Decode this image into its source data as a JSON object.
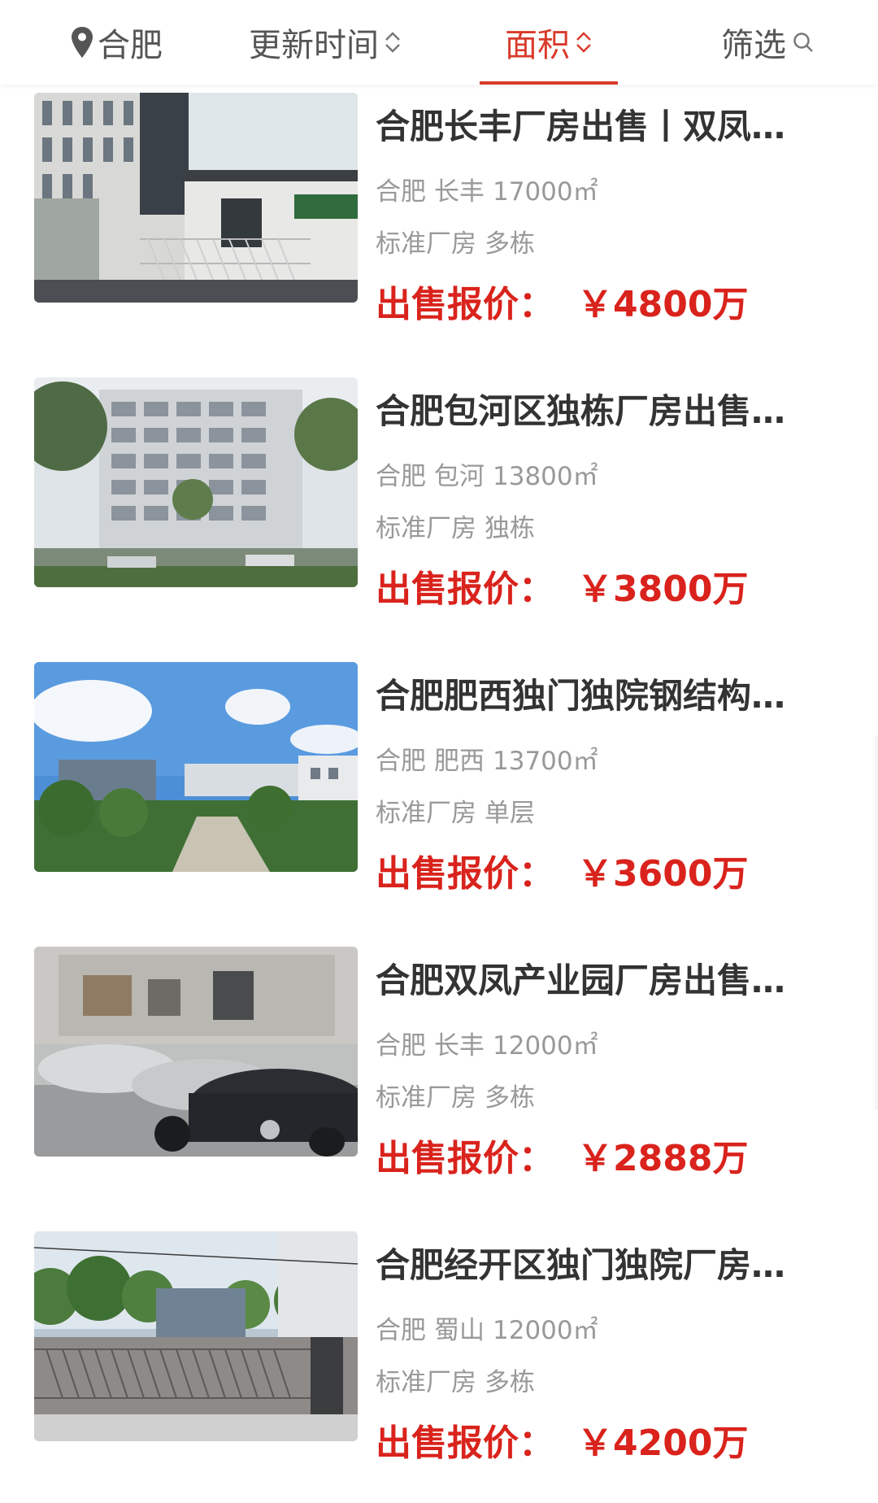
{
  "header": {
    "tabs": [
      {
        "label": "合肥"
      },
      {
        "label": "更新时间"
      },
      {
        "label": "面积"
      },
      {
        "label": "筛选"
      }
    ],
    "accent_color": "#d93a2b"
  },
  "listings": [
    {
      "title": "合肥长丰厂房出售丨双凤…",
      "city": "合肥",
      "district": "长丰",
      "area": "17000㎡",
      "type": "标准厂房",
      "building": "多栋",
      "price_label": "出售报价：",
      "price": "￥4800万"
    },
    {
      "title": "合肥包河区独栋厂房出售…",
      "city": "合肥",
      "district": "包河",
      "area": "13800㎡",
      "type": "标准厂房",
      "building": "独栋",
      "price_label": "出售报价：",
      "price": "￥3800万"
    },
    {
      "title": "合肥肥西独门独院钢结构…",
      "city": "合肥",
      "district": "肥西",
      "area": "13700㎡",
      "type": "标准厂房",
      "building": "单层",
      "price_label": "出售报价：",
      "price": "￥3600万"
    },
    {
      "title": "合肥双凤产业园厂房出售…",
      "city": "合肥",
      "district": "长丰",
      "area": "12000㎡",
      "type": "标准厂房",
      "building": "多栋",
      "price_label": "出售报价：",
      "price": "￥2888万"
    },
    {
      "title": "合肥经开区独门独院厂房…",
      "city": "合肥",
      "district": "蜀山",
      "area": "12000㎡",
      "type": "标准厂房",
      "building": "多栋",
      "price_label": "出售报价：",
      "price": "￥4200万"
    }
  ]
}
